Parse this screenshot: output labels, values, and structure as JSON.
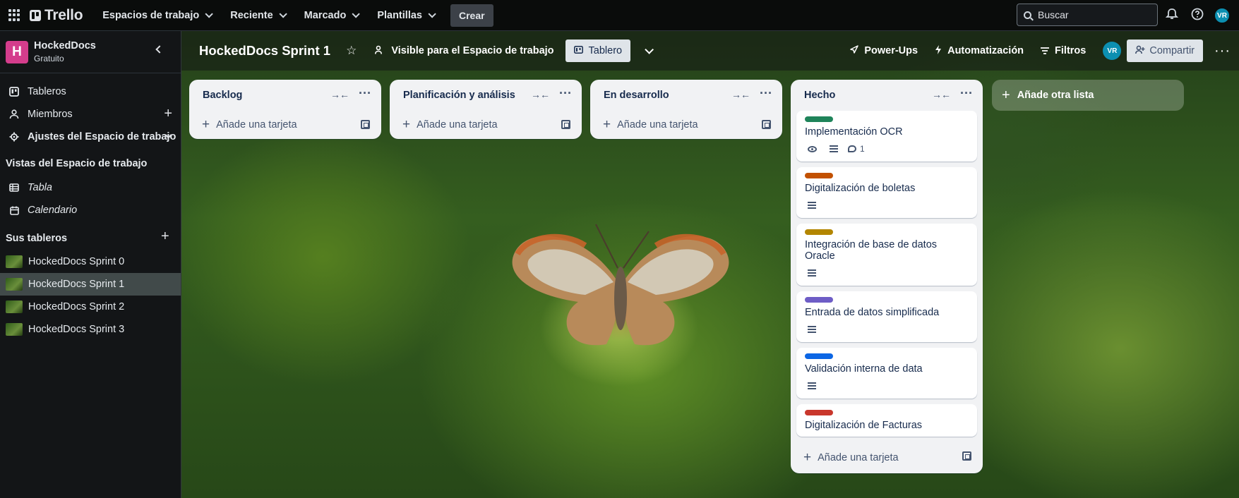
{
  "topbar": {
    "brand": "Trello",
    "nav": [
      "Espacios de trabajo",
      "Reciente",
      "Marcado",
      "Plantillas"
    ],
    "create_label": "Crear",
    "search_placeholder": "Buscar",
    "avatar_initials": "VR"
  },
  "sidebar": {
    "workspace_initial": "H",
    "workspace_name": "HockedDocs",
    "workspace_plan": "Gratuito",
    "items": [
      {
        "label": "Tableros",
        "icon": "board-icon"
      },
      {
        "label": "Miembros",
        "icon": "person-icon"
      },
      {
        "label": "Ajustes del Espacio de trabajo",
        "icon": "gear-icon"
      }
    ],
    "views_heading": "Vistas del Espacio de trabajo",
    "views": [
      "Tabla",
      "Calendario"
    ],
    "boards_heading": "Sus tableros",
    "boards": [
      "HockedDocs Sprint 0",
      "HockedDocs Sprint 1",
      "HockedDocs Sprint 2",
      "HockedDocs Sprint 3"
    ],
    "active_board": "HockedDocs Sprint 1"
  },
  "board_header": {
    "title": "HockedDocs Sprint 1",
    "visibility": "Visible para el Espacio de trabajo",
    "view": "Tablero",
    "powerups": "Power-Ups",
    "automation": "Automatización",
    "filters": "Filtros",
    "avatar_initials": "VR",
    "share": "Compartir"
  },
  "lists": [
    {
      "title": "Backlog",
      "add_card": "Añade una tarjeta",
      "cards": []
    },
    {
      "title": "Planificación y análisis",
      "add_card": "Añade una tarjeta",
      "cards": []
    },
    {
      "title": "En desarrollo",
      "add_card": "Añade una tarjeta",
      "cards": []
    },
    {
      "title": "Hecho",
      "add_card": "Añade una tarjeta",
      "cards": [
        {
          "title": "Implementación OCR",
          "label_color": "#1f845a",
          "watch": true,
          "description": true,
          "comments": "1"
        },
        {
          "title": "Digitalización de boletas",
          "label_color": "#c25100",
          "description": true
        },
        {
          "title": "Integración de base de datos Oracle",
          "label_color": "#b38600",
          "description": true
        },
        {
          "title": "Entrada de datos simplificada",
          "label_color": "#6e5dc6",
          "description": true
        },
        {
          "title": "Validación interna de data",
          "label_color": "#0c66e4",
          "description": true
        },
        {
          "title": "Digitalización de Facturas",
          "label_color": "#c9372c"
        }
      ]
    }
  ],
  "add_list": "Añade otra lista"
}
